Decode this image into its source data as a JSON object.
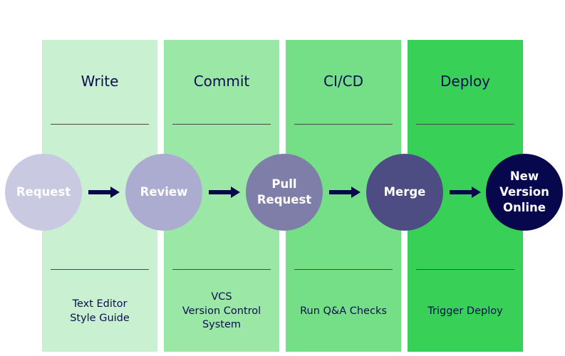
{
  "columns": [
    {
      "title": "Write",
      "desc": [
        "Text Editor",
        "Style Guide"
      ],
      "color": "#c9f1d1"
    },
    {
      "title": "Commit",
      "desc": [
        "VCS",
        "Version Control",
        "System"
      ],
      "color": "#9ae7a6"
    },
    {
      "title": "CI/CD",
      "desc": [
        "Run Q&A Checks"
      ],
      "color": "#74df86"
    },
    {
      "title": "Deploy",
      "desc": [
        "Trigger Deploy"
      ],
      "color": "#38d057"
    }
  ],
  "nodes": [
    {
      "label": [
        "Request"
      ],
      "color": "#c9c9e1"
    },
    {
      "label": [
        "Review"
      ],
      "color": "#acacd1"
    },
    {
      "label": [
        "Pull",
        "Request"
      ],
      "color": "#7e7ea8"
    },
    {
      "label": [
        "Merge"
      ],
      "color": "#4d4d84"
    },
    {
      "label": [
        "New",
        "Version",
        "Online"
      ],
      "color": "#07074d"
    }
  ],
  "arrow_color": "#07074d",
  "text_color": "#0d0d52"
}
